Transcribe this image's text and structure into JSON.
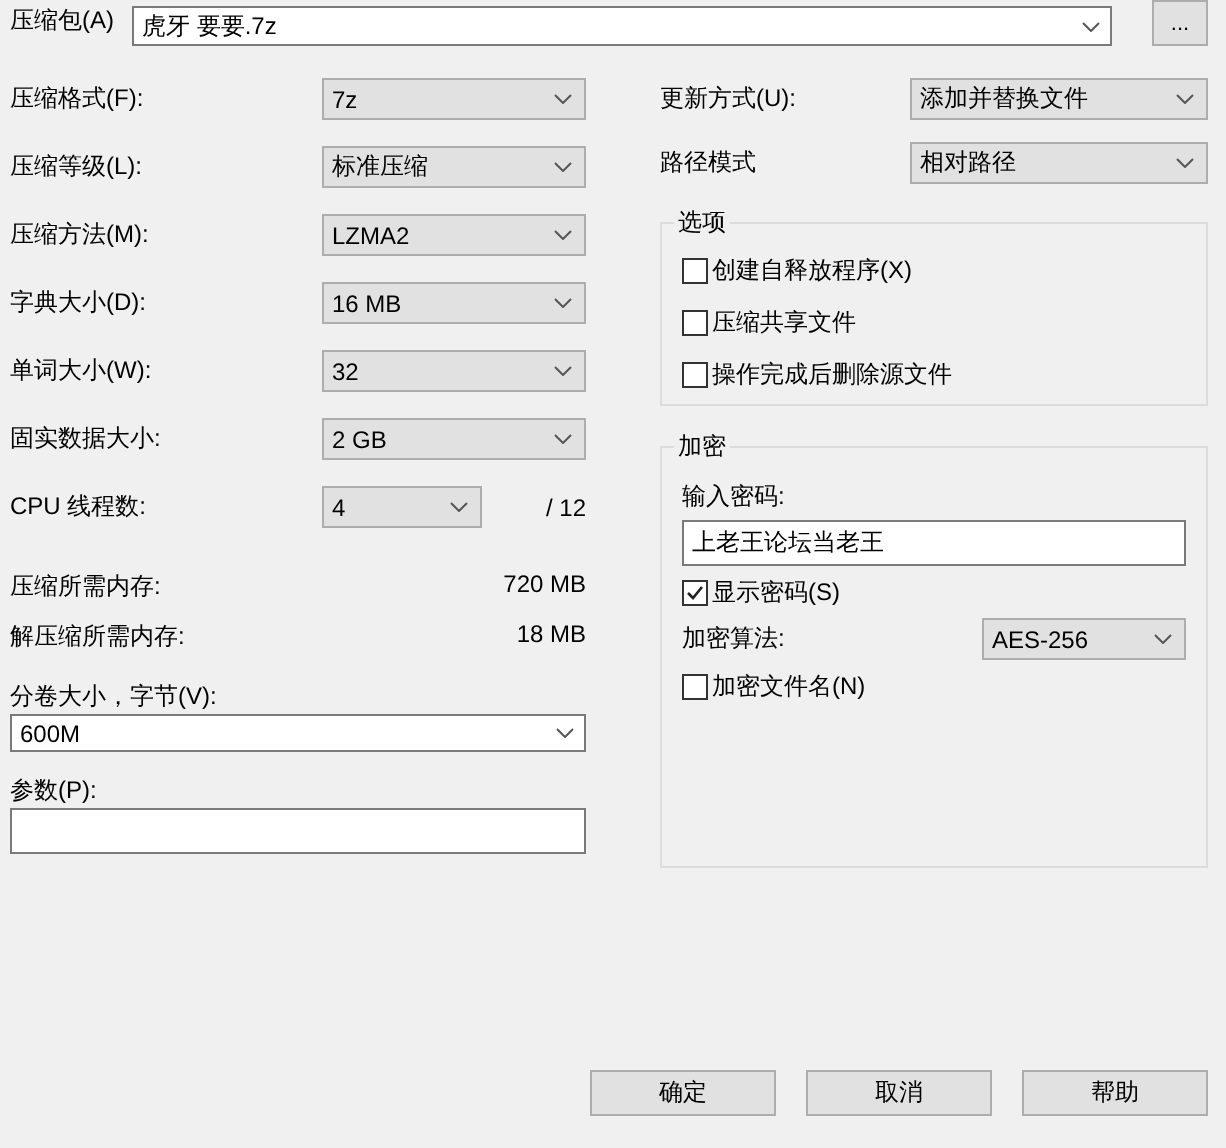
{
  "archive": {
    "label": "压缩包(A)",
    "value": "虎牙 要要.7z",
    "browse_button": "..."
  },
  "settings": [
    {
      "label": "压缩格式(F):",
      "value": "7z"
    },
    {
      "label": "压缩等级(L):",
      "value": "标准压缩"
    },
    {
      "label": "压缩方法(M):",
      "value": "LZMA2"
    },
    {
      "label": "字典大小(D):",
      "value": "16 MB"
    },
    {
      "label": "单词大小(W):",
      "value": "32"
    },
    {
      "label": "固实数据大小:",
      "value": "2 GB"
    }
  ],
  "cpu_threads": {
    "label": "CPU 线程数:",
    "value": "4",
    "total": "/ 12"
  },
  "memory": [
    {
      "label": "压缩所需内存:",
      "value": "720 MB"
    },
    {
      "label": "解压缩所需内存:",
      "value": "18 MB"
    }
  ],
  "volume": {
    "label": "分卷大小，字节(V):",
    "value": "600M"
  },
  "parameters": {
    "label": "参数(P):"
  },
  "update_mode": {
    "label": "更新方式(U):",
    "value": "添加并替换文件"
  },
  "path_mode": {
    "label": "路径模式",
    "value": "相对路径"
  },
  "options": {
    "title": "选项",
    "items": [
      {
        "label": "创建自释放程序(X)",
        "checked": false
      },
      {
        "label": "压缩共享文件",
        "checked": false
      },
      {
        "label": "操作完成后删除源文件",
        "checked": false
      }
    ]
  },
  "encryption": {
    "title": "加密",
    "password_label": "输入密码:",
    "password": "上老王论坛当老王",
    "show_password": {
      "label": "显示密码(S)",
      "checked": true
    },
    "method": {
      "label": "加密算法:",
      "value": "AES-256"
    },
    "encrypt_names": {
      "label": "加密文件名(N)",
      "checked": false
    }
  },
  "buttons": [
    "确定",
    "取消",
    "帮助"
  ]
}
